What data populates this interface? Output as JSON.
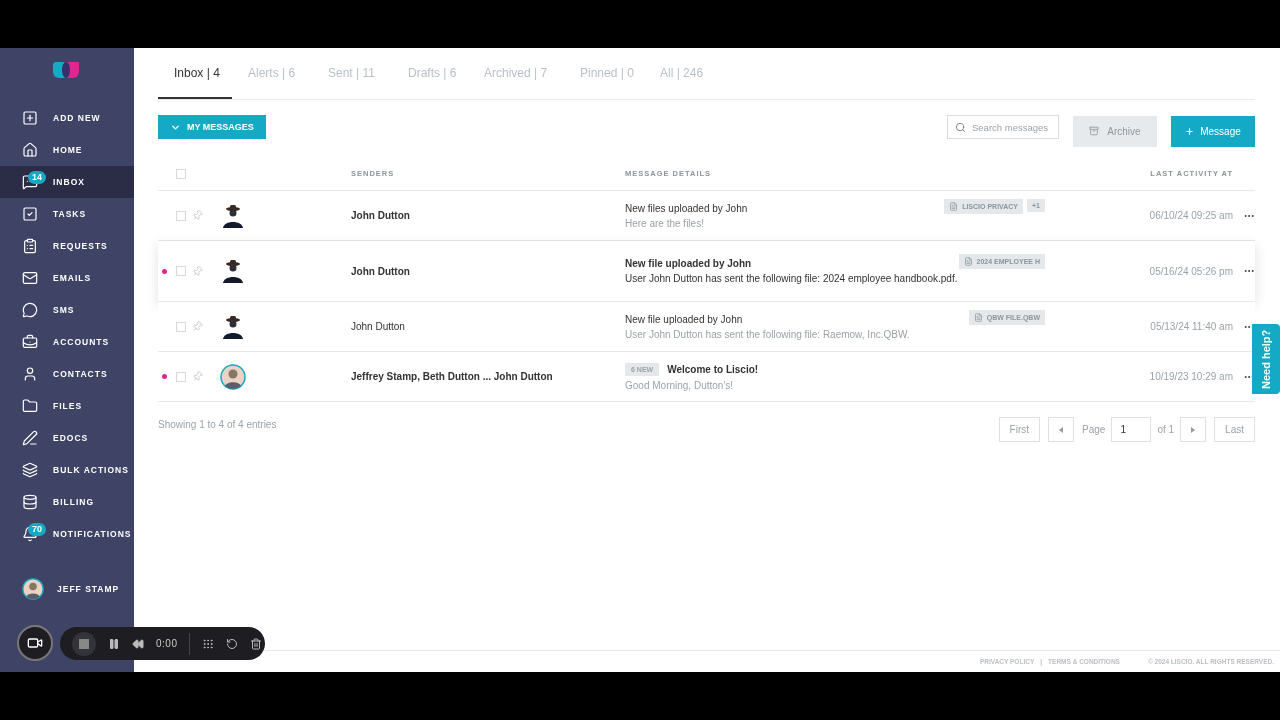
{
  "sidebar": {
    "items": [
      {
        "label": "ADD NEW",
        "selected": false
      },
      {
        "label": "HOME",
        "selected": false
      },
      {
        "label": "INBOX",
        "selected": true,
        "badge": "14"
      },
      {
        "label": "TASKS",
        "selected": false
      },
      {
        "label": "REQUESTS",
        "selected": false
      },
      {
        "label": "EMAILS",
        "selected": false
      },
      {
        "label": "SMS",
        "selected": false
      },
      {
        "label": "ACCOUNTS",
        "selected": false
      },
      {
        "label": "CONTACTS",
        "selected": false
      },
      {
        "label": "FILES",
        "selected": false
      },
      {
        "label": "EDOCS",
        "selected": false
      },
      {
        "label": "BULK ACTIONS",
        "selected": false
      },
      {
        "label": "BILLING",
        "selected": false
      },
      {
        "label": "NOTIFICATIONS",
        "selected": false,
        "badge": "70"
      }
    ],
    "user": {
      "name": "JEFF STAMP"
    }
  },
  "tabs": [
    {
      "label": "Inbox | 4",
      "selected": true
    },
    {
      "label": "Alerts | 6",
      "selected": false
    },
    {
      "label": "Sent | 11",
      "selected": false
    },
    {
      "label": "Drafts | 6",
      "selected": false
    },
    {
      "label": "Archived | 7",
      "selected": false
    },
    {
      "label": "Pinned | 0",
      "selected": false
    },
    {
      "label": "All | 246",
      "selected": false
    }
  ],
  "filter_button": {
    "label": "MY MESSAGES"
  },
  "search": {
    "placeholder": "Search messages"
  },
  "archive_button": {
    "label": "Archive",
    "disabled": true
  },
  "message_button": {
    "label": "Message"
  },
  "table": {
    "select_all_checked": false,
    "columns": [
      "SENDERS",
      "MESSAGE DETAILS",
      "LAST ACTIVITY AT"
    ],
    "rows": [
      {
        "unread": false,
        "highlighted": false,
        "checked": false,
        "pinned": false,
        "kind": "direct",
        "sender": "John Dutton",
        "sender_bold": true,
        "title": "New files uploaded by John",
        "title_bold": false,
        "preview": "Here are the files!",
        "attachments": [
          {
            "kind": "file",
            "label": "LISCIO PRIVACY"
          },
          {
            "kind": "more",
            "label": "+1"
          }
        ],
        "date": "06/10/24 09:25 am"
      },
      {
        "unread": true,
        "highlighted": true,
        "checked": false,
        "pinned": false,
        "kind": "direct",
        "sender": "John Dutton",
        "sender_bold": true,
        "title": "New file uploaded by John",
        "title_bold": true,
        "preview": "User John Dutton has sent the following file: 2024 employee handbook.pdf.",
        "attachments": [
          {
            "kind": "file",
            "label": "2024 EMPLOYEE H"
          }
        ],
        "date": "05/16/24 05:26 pm"
      },
      {
        "unread": false,
        "highlighted": false,
        "checked": false,
        "pinned": false,
        "kind": "direct",
        "sender": "John Dutton",
        "sender_bold": false,
        "title": "New file uploaded by John",
        "title_bold": false,
        "preview": "User John Dutton has sent the following file: Raemow, Inc.QBW.",
        "attachments": [
          {
            "kind": "file",
            "label": "QBW FILE.QBW"
          }
        ],
        "date": "05/13/24 11:40 am"
      },
      {
        "unread": true,
        "highlighted": false,
        "checked": false,
        "pinned": false,
        "kind": "group",
        "sender": "Jeffrey Stamp, Beth Dutton ... John Dutton",
        "sender_bold": true,
        "new_badge": "6 NEW",
        "title": "Welcome to Liscio!",
        "title_bold": true,
        "preview": "Good Morning, Dutton's!",
        "attachments": [],
        "date": "10/19/23 10:29 am"
      }
    ]
  },
  "entries_info": "Showing 1 to 4 of 4 entries",
  "pagination": {
    "first": "First",
    "page_label": "Page",
    "page": "1",
    "of": "of 1",
    "last": "Last"
  },
  "footer": {
    "links": [
      "PRIVACY POLICY",
      "TERMS & CONDITIONS"
    ],
    "separator": "|",
    "copyright": "© 2024 LISCIO. ALL RIGHTS RESERVED."
  },
  "help_tab": "Need help?",
  "recorder": {
    "time": "0:00"
  }
}
